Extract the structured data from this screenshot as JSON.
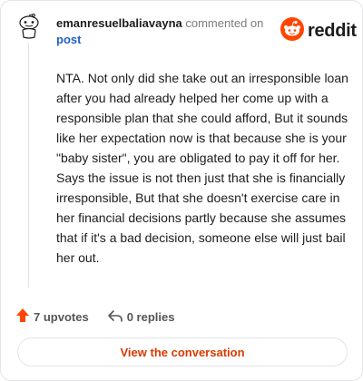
{
  "comment": {
    "username": "emanresuelbaliavayna",
    "action_text": "commented on",
    "target_link": "post",
    "body": "NTA. Not only did she take out an irresponsible loan after you had already helped her come up with a responsible plan that she could afford, But it sounds like her expectation now is that because she is your \"baby sister\", you are obligated to pay it off for her. Says the issue is not then just that she is financially irresponsible, But that she doesn't exercise care in her financial decisions partly because she assumes that if it's a bad decision, someone else will just bail her out."
  },
  "brand": {
    "wordmark": "reddit",
    "icon": "reddit-snoo-icon",
    "color": "#ff4500"
  },
  "stats": {
    "upvotes_label": "7 upvotes",
    "upvote_icon": "upvote-arrow-icon",
    "upvote_color": "#ff4500",
    "replies_label": "0 replies",
    "reply_icon": "reply-arrow-icon"
  },
  "cta": {
    "label": "View the conversation",
    "color": "#d93a00"
  }
}
